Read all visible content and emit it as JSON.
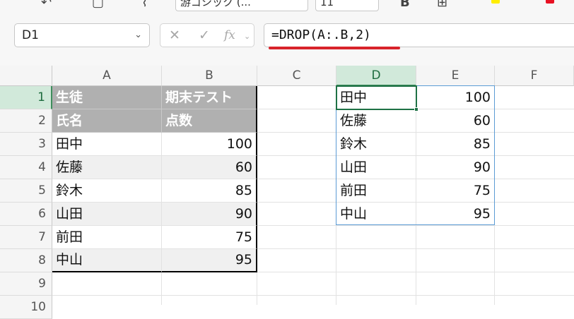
{
  "ribbon": {
    "font_name": "游ゴシック (...",
    "font_size": "11"
  },
  "formula_bar": {
    "name_box": "D1",
    "cancel_icon": "✕",
    "enter_icon": "✓",
    "fx_label": "fx",
    "formula": "=DROP(A:.B,2)"
  },
  "columns": [
    "A",
    "B",
    "C",
    "D",
    "E",
    "F"
  ],
  "selected_column": "D",
  "rows": [
    "1",
    "2",
    "3",
    "4",
    "5",
    "6",
    "7",
    "8",
    "9",
    "10"
  ],
  "selected_row": "1",
  "source_table": {
    "header_row1": [
      "生徒",
      "期末テスト"
    ],
    "header_row2": [
      "氏名",
      "点数"
    ],
    "data": [
      {
        "name": "田中",
        "score": "100"
      },
      {
        "name": "佐藤",
        "score": "60"
      },
      {
        "name": "鈴木",
        "score": "85"
      },
      {
        "name": "山田",
        "score": "90"
      },
      {
        "name": "前田",
        "score": "75"
      },
      {
        "name": "中山",
        "score": "95"
      }
    ]
  },
  "spill_result": [
    {
      "name": "田中",
      "score": "100"
    },
    {
      "name": "佐藤",
      "score": "60"
    },
    {
      "name": "鈴木",
      "score": "85"
    },
    {
      "name": "山田",
      "score": "90"
    },
    {
      "name": "前田",
      "score": "75"
    },
    {
      "name": "中山",
      "score": "95"
    }
  ],
  "colors": {
    "selection": "#1e7145",
    "header_fill": "#b0b0b0",
    "highlight_underline": "#d8232a",
    "spill_border": "#5b9bd5"
  }
}
